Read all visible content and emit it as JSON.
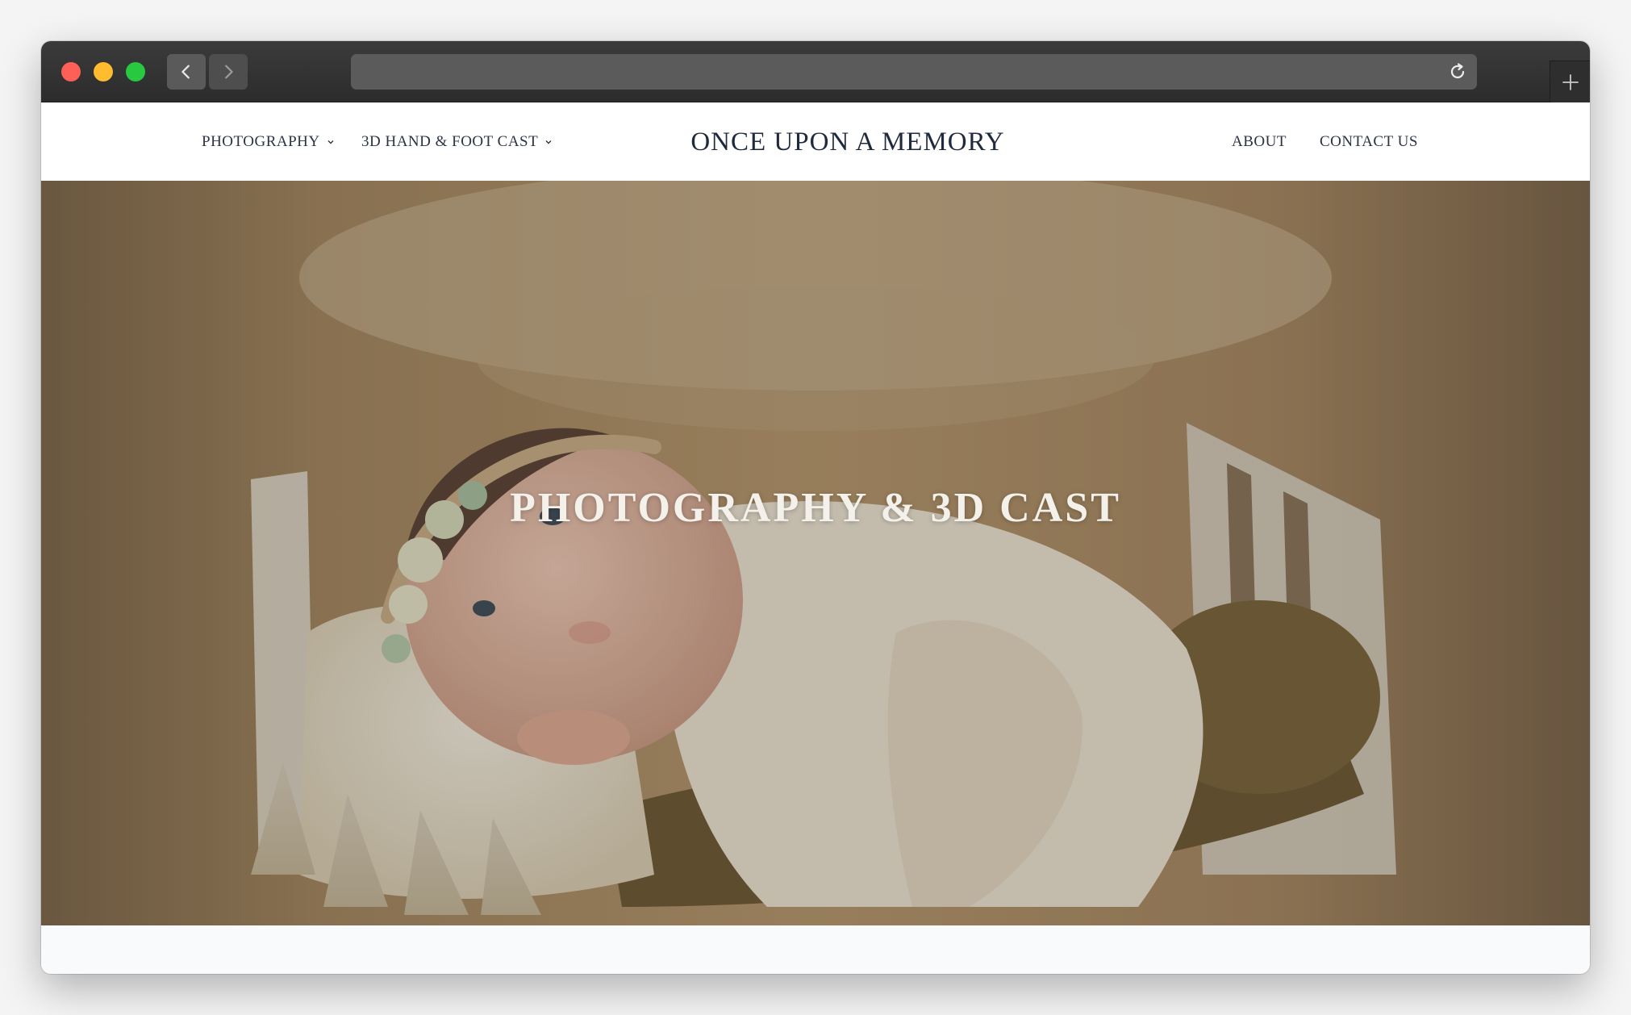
{
  "browser": {
    "url": "",
    "icons": {
      "back": "chevron-left-icon",
      "forward": "chevron-right-icon",
      "reload": "reload-icon",
      "new_tab": "plus-icon"
    }
  },
  "site": {
    "brand": "ONCE UPON A MEMORY",
    "nav_left": [
      {
        "label": "PHOTOGRAPHY",
        "has_dropdown": true
      },
      {
        "label": "3D HAND & FOOT CAST",
        "has_dropdown": true
      }
    ],
    "nav_right": [
      {
        "label": "ABOUT"
      },
      {
        "label": "CONTACT US"
      }
    ]
  },
  "hero": {
    "title": "PHOTOGRAPHY & 3D CAST"
  },
  "colors": {
    "nav_text": "#2b3444",
    "brand_text": "#1f2a3c",
    "hero_text": "#f4f1ea",
    "titlebar": "#333333"
  }
}
